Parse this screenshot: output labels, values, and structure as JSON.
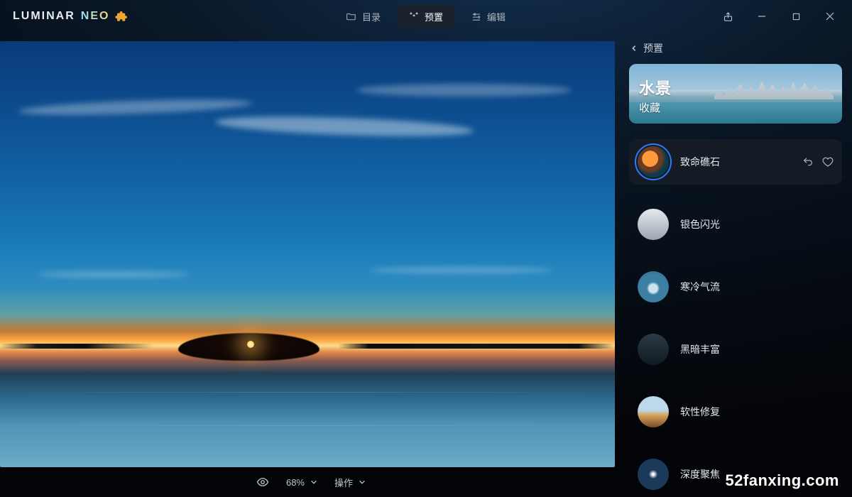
{
  "app": {
    "logo_main": "LUMINAR",
    "logo_sub": "NEO"
  },
  "nav": {
    "catalog": "目录",
    "presets": "预置",
    "edit": "编辑"
  },
  "viewer": {
    "zoom": "68%",
    "actions": "操作"
  },
  "panel": {
    "back_label": "预置",
    "category_title": "水景",
    "category_sub": "收藏",
    "presets": [
      {
        "name": "致命礁石"
      },
      {
        "name": "银色闪光"
      },
      {
        "name": "寒冷气流"
      },
      {
        "name": "黑暗丰富"
      },
      {
        "name": "软性修复"
      },
      {
        "name": "深度聚焦"
      }
    ]
  },
  "watermark": "52fanxing.com"
}
